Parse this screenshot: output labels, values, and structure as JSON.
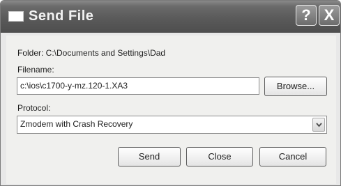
{
  "window": {
    "title": "Send File",
    "help_glyph": "?",
    "close_glyph": "X"
  },
  "folder_line": "Folder:  C:\\Documents and Settings\\Dad",
  "filename": {
    "label": "Filename:",
    "value": "c:\\ios\\c1700-y-mz.120-1.XA3",
    "browse_label": "Browse..."
  },
  "protocol": {
    "label": "Protocol:",
    "selected": "Zmodem with Crash Recovery"
  },
  "buttons": {
    "send": "Send",
    "close": "Close",
    "cancel": "Cancel"
  },
  "icons": [
    "window-icon",
    "help-icon",
    "close-icon",
    "chevron-down-icon"
  ]
}
